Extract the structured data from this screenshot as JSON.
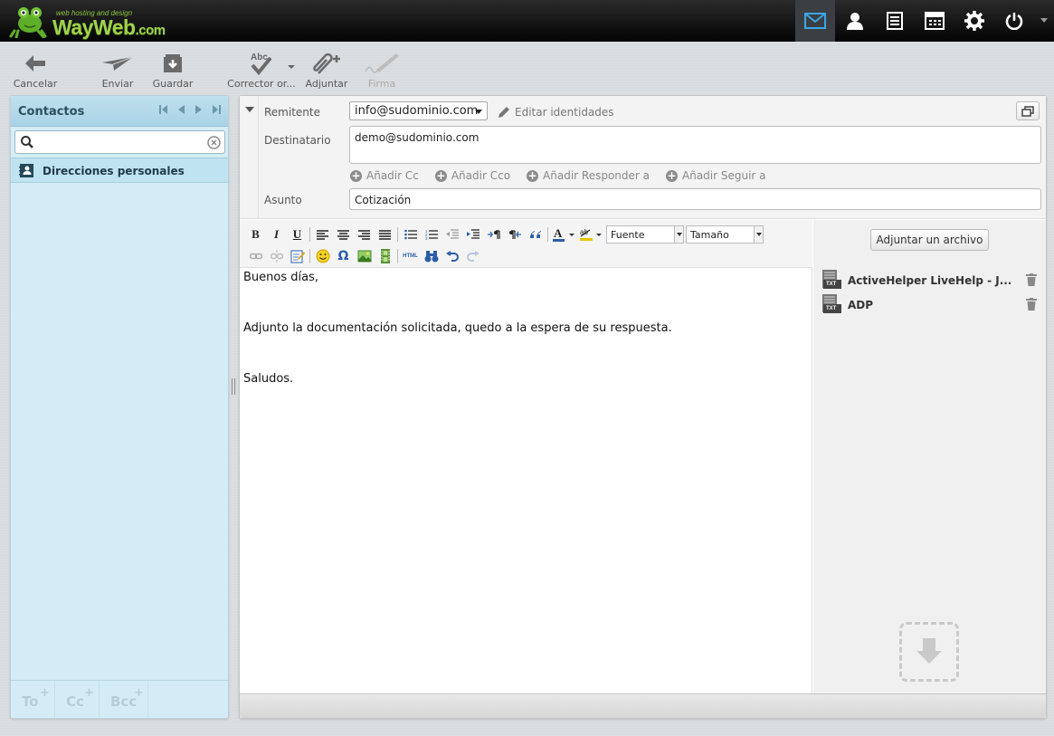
{
  "brand": {
    "tagline": "web hosting and design",
    "name": "WayWeb",
    "suffix": ".com",
    "color": "#9fd34b"
  },
  "topnav": {
    "items": [
      "mail-icon",
      "contacts-icon",
      "list-icon",
      "calendar-icon",
      "settings-icon",
      "power-icon"
    ],
    "active_color": "#3b3f43"
  },
  "toolbar": {
    "cancel": "Cancelar",
    "send": "Enviar",
    "save": "Guardar",
    "spell": "Corrector or...",
    "attach": "Adjuntar",
    "signature": "Firma"
  },
  "sidebar": {
    "title": "Contactos",
    "search_placeholder": "",
    "group": "Direcciones personales",
    "footer": {
      "to": "To",
      "cc": "Cc",
      "bcc": "Bcc",
      "plus": "+"
    }
  },
  "compose": {
    "labels": {
      "from": "Remitente",
      "to": "Destinatario",
      "subject": "Asunto"
    },
    "from_value": "info@sudominio.com",
    "edit_identities": "Editar identidades",
    "to_value": "demo@sudominio.com",
    "add_links": {
      "cc": "Añadir Cc",
      "bcc": "Añadir Cco",
      "reply_to": "Añadir Responder a",
      "followup_to": "Añadir Seguir a"
    },
    "subject_value": "Cotización"
  },
  "editor": {
    "bold": "B",
    "italic": "I",
    "underline": "U",
    "font_select": "Fuente",
    "size_select": "Tamaño",
    "html_label": "HTML",
    "body": {
      "line1": "Buenos días,",
      "line2": "Adjunto la documentación solicitada, quedo a la espera de su respuesta.",
      "line3": "Saludos."
    }
  },
  "attachments": {
    "button": "Adjuntar un archivo",
    "file_badge": "TXT",
    "items": [
      {
        "name": "ActiveHelper LiveHelp - J..."
      },
      {
        "name": "ADP"
      }
    ]
  }
}
